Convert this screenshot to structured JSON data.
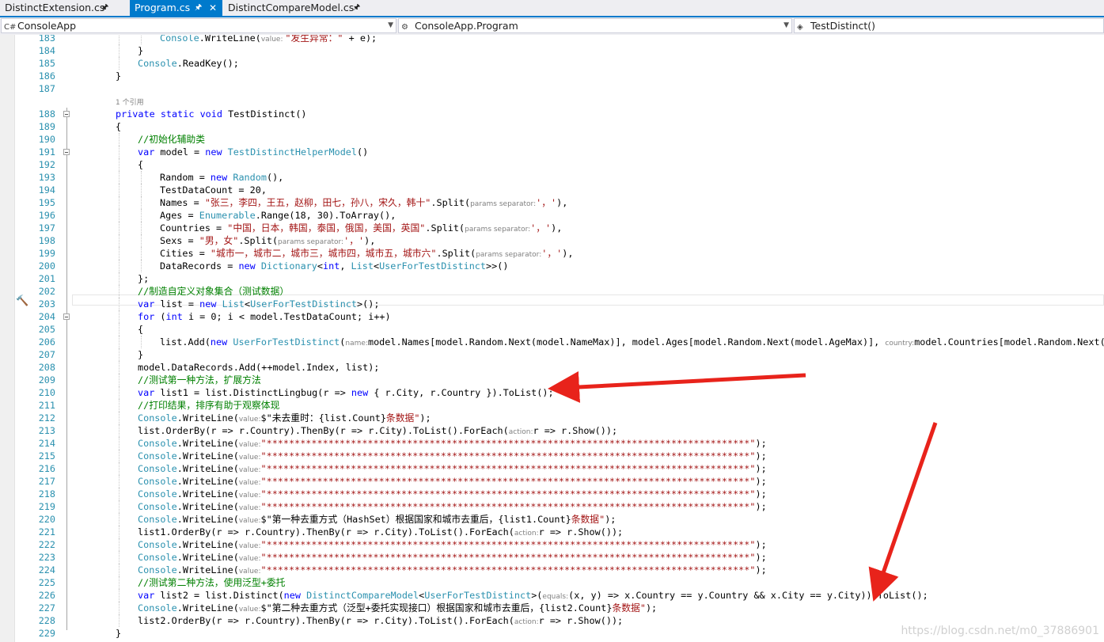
{
  "tabs": [
    {
      "label": "DistinctExtension.cs",
      "active": false
    },
    {
      "label": "Program.cs",
      "active": true
    },
    {
      "label": "DistinctCompareModel.cs",
      "active": false
    }
  ],
  "nav": {
    "project": "ConsoleApp",
    "type": "ConsoleApp.Program",
    "member": "TestDistinct()"
  },
  "colors": {
    "keyword": "#0000ff",
    "type": "#2b91af",
    "string": "#a31515",
    "comment": "#008000",
    "hint": "#808080",
    "accent": "#007acc",
    "arrow": "#e8231b"
  },
  "lines": [
    {
      "n": "183",
      "ind": 2,
      "t": [
        [
          "Console",
          "type"
        ],
        [
          ".WriteLine(",
          ""
        ],
        [
          "value: ",
          "hint"
        ],
        [
          "\"发生异常：\"",
          "string"
        ],
        [
          " + e);",
          ""
        ]
      ]
    },
    {
      "n": "184",
      "ind": 1,
      "t": [
        [
          "}",
          ""
        ]
      ]
    },
    {
      "n": "185",
      "ind": 1,
      "t": [
        [
          "Console",
          "type"
        ],
        [
          ".ReadKey();",
          ""
        ]
      ]
    },
    {
      "n": "186",
      "ind": 0,
      "t": [
        [
          "}",
          ""
        ]
      ]
    },
    {
      "n": "187",
      "ind": 0,
      "t": []
    },
    {
      "n": "",
      "ind": 0,
      "t": [
        [
          "1 个引用",
          "hint"
        ]
      ]
    },
    {
      "n": "188",
      "ind": 0,
      "fold": true,
      "t": [
        [
          "private",
          "keyword"
        ],
        [
          " ",
          ""
        ],
        [
          "static",
          "keyword"
        ],
        [
          " ",
          ""
        ],
        [
          "void",
          "keyword"
        ],
        [
          " TestDistinct()",
          ""
        ]
      ]
    },
    {
      "n": "189",
      "ind": 0,
      "t": [
        [
          "{",
          ""
        ]
      ]
    },
    {
      "n": "190",
      "ind": 1,
      "t": [
        [
          "//初始化辅助类",
          "comment"
        ]
      ]
    },
    {
      "n": "191",
      "ind": 1,
      "fold": true,
      "t": [
        [
          "var",
          "keyword"
        ],
        [
          " model = ",
          ""
        ],
        [
          "new",
          "keyword"
        ],
        [
          " ",
          ""
        ],
        [
          "TestDistinctHelperModel",
          "type"
        ],
        [
          "()",
          ""
        ]
      ]
    },
    {
      "n": "192",
      "ind": 1,
      "t": [
        [
          "{",
          ""
        ]
      ]
    },
    {
      "n": "193",
      "ind": 2,
      "t": [
        [
          "Random = ",
          ""
        ],
        [
          "new",
          "keyword"
        ],
        [
          " ",
          ""
        ],
        [
          "Random",
          "type"
        ],
        [
          "(),",
          ""
        ]
      ]
    },
    {
      "n": "194",
      "ind": 2,
      "t": [
        [
          "TestDataCount = 20,",
          ""
        ]
      ]
    },
    {
      "n": "195",
      "ind": 2,
      "t": [
        [
          "Names = ",
          ""
        ],
        [
          "\"张三，李四，王五，赵柳，田七，孙八，宋久，韩十\"",
          "string"
        ],
        [
          ".Split(",
          ""
        ],
        [
          "params separator:",
          "hint"
        ],
        [
          "'，'",
          "string"
        ],
        [
          "),",
          ""
        ]
      ]
    },
    {
      "n": "196",
      "ind": 2,
      "t": [
        [
          "Ages = ",
          ""
        ],
        [
          "Enumerable",
          "type"
        ],
        [
          ".Range(18, 30).ToArray(),",
          ""
        ]
      ]
    },
    {
      "n": "197",
      "ind": 2,
      "t": [
        [
          "Countries = ",
          ""
        ],
        [
          "\"中国，日本，韩国，泰国，俄国，美国，英国\"",
          "string"
        ],
        [
          ".Split(",
          ""
        ],
        [
          "params separator:",
          "hint"
        ],
        [
          "'，'",
          "string"
        ],
        [
          "),",
          ""
        ]
      ]
    },
    {
      "n": "198",
      "ind": 2,
      "t": [
        [
          "Sexs = ",
          ""
        ],
        [
          "\"男，女\"",
          "string"
        ],
        [
          ".Split(",
          ""
        ],
        [
          "params separator:",
          "hint"
        ],
        [
          "'，'",
          "string"
        ],
        [
          "),",
          ""
        ]
      ]
    },
    {
      "n": "199",
      "ind": 2,
      "t": [
        [
          "Cities = ",
          ""
        ],
        [
          "\"城市一，城市二，城市三，城市四，城市五，城市六\"",
          "string"
        ],
        [
          ".Split(",
          ""
        ],
        [
          "params separator:",
          "hint"
        ],
        [
          "'，'",
          "string"
        ],
        [
          "),",
          ""
        ]
      ]
    },
    {
      "n": "200",
      "ind": 2,
      "t": [
        [
          "DataRecords = ",
          ""
        ],
        [
          "new",
          "keyword"
        ],
        [
          " ",
          ""
        ],
        [
          "Dictionary",
          "type"
        ],
        [
          "<",
          ""
        ],
        [
          "int",
          "keyword"
        ],
        [
          ", ",
          ""
        ],
        [
          "List",
          "type"
        ],
        [
          "<",
          ""
        ],
        [
          "UserForTestDistinct",
          "type"
        ],
        [
          ">>()",
          ""
        ]
      ]
    },
    {
      "n": "201",
      "ind": 1,
      "t": [
        [
          "};",
          ""
        ]
      ]
    },
    {
      "n": "202",
      "ind": 1,
      "t": [
        [
          "//制造自定义对象集合（测试数据）",
          "comment"
        ]
      ]
    },
    {
      "n": "203",
      "ind": 1,
      "t": [
        [
          "var",
          "keyword"
        ],
        [
          " list = ",
          ""
        ],
        [
          "new",
          "keyword"
        ],
        [
          " ",
          ""
        ],
        [
          "List",
          "type"
        ],
        [
          "<",
          ""
        ],
        [
          "UserForTestDistinct",
          "type"
        ],
        [
          ">();",
          ""
        ]
      ]
    },
    {
      "n": "204",
      "ind": 1,
      "fold": true,
      "t": [
        [
          "for",
          "keyword"
        ],
        [
          " (",
          ""
        ],
        [
          "int",
          "keyword"
        ],
        [
          " i = 0; i < model.TestDataCount; i++)",
          ""
        ]
      ]
    },
    {
      "n": "205",
      "ind": 1,
      "t": [
        [
          "{",
          ""
        ]
      ]
    },
    {
      "n": "206",
      "ind": 2,
      "t": [
        [
          "list.Add(",
          ""
        ],
        [
          "new",
          "keyword"
        ],
        [
          " ",
          ""
        ],
        [
          "UserForTestDistinct",
          "type"
        ],
        [
          "(",
          ""
        ],
        [
          "name:",
          "hint"
        ],
        [
          "model.Names[model.Random.Next(model.NameMax)], model.Ages[model.Random.Next(model.AgeMax)], ",
          ""
        ],
        [
          "country:",
          "hint"
        ],
        [
          "model.Countries[model.Random.Next(model.CountryMax)]",
          ""
        ]
      ]
    },
    {
      "n": "207",
      "ind": 1,
      "t": [
        [
          "}",
          ""
        ]
      ]
    },
    {
      "n": "208",
      "ind": 1,
      "t": [
        [
          "model.DataRecords.Add(++model.Index, list);",
          ""
        ]
      ]
    },
    {
      "n": "209",
      "ind": 1,
      "t": [
        [
          "//测试第一种方法，扩展方法",
          "comment"
        ]
      ]
    },
    {
      "n": "210",
      "ind": 1,
      "t": [
        [
          "var",
          "keyword"
        ],
        [
          " list1 = list.DistinctLingbug(r => ",
          ""
        ],
        [
          "new",
          "keyword"
        ],
        [
          " { r.City, r.Country }).ToList();",
          ""
        ]
      ]
    },
    {
      "n": "211",
      "ind": 1,
      "t": [
        [
          "//打印结果，排序有助于观察体现",
          "comment"
        ]
      ]
    },
    {
      "n": "212",
      "ind": 1,
      "t": [
        [
          "Console",
          "type"
        ],
        [
          ".WriteLine(",
          ""
        ],
        [
          "value:",
          "hint"
        ],
        [
          "$\"未去重时：",
          ""
        ],
        [
          "{list.Count}",
          ""
        ],
        [
          "条数据\"",
          "string"
        ],
        [
          ");",
          ""
        ]
      ]
    },
    {
      "n": "213",
      "ind": 1,
      "t": [
        [
          "list.OrderBy(r => r.Country).ThenBy(r => r.City).ToList().ForEach(",
          ""
        ],
        [
          "action:",
          "hint"
        ],
        [
          "r => r.Show());",
          ""
        ]
      ]
    },
    {
      "n": "214",
      "ind": 1,
      "t": [
        [
          "Console",
          "type"
        ],
        [
          ".WriteLine(",
          ""
        ],
        [
          "value:",
          "hint"
        ],
        [
          "\"**************************************************************************************\"",
          "string"
        ],
        [
          ");",
          ""
        ]
      ]
    },
    {
      "n": "215",
      "ind": 1,
      "t": [
        [
          "Console",
          "type"
        ],
        [
          ".WriteLine(",
          ""
        ],
        [
          "value:",
          "hint"
        ],
        [
          "\"**************************************************************************************\"",
          "string"
        ],
        [
          ");",
          ""
        ]
      ]
    },
    {
      "n": "216",
      "ind": 1,
      "t": [
        [
          "Console",
          "type"
        ],
        [
          ".WriteLine(",
          ""
        ],
        [
          "value:",
          "hint"
        ],
        [
          "\"**************************************************************************************\"",
          "string"
        ],
        [
          ");",
          ""
        ]
      ]
    },
    {
      "n": "217",
      "ind": 1,
      "t": [
        [
          "Console",
          "type"
        ],
        [
          ".WriteLine(",
          ""
        ],
        [
          "value:",
          "hint"
        ],
        [
          "\"**************************************************************************************\"",
          "string"
        ],
        [
          ");",
          ""
        ]
      ]
    },
    {
      "n": "218",
      "ind": 1,
      "t": [
        [
          "Console",
          "type"
        ],
        [
          ".WriteLine(",
          ""
        ],
        [
          "value:",
          "hint"
        ],
        [
          "\"**************************************************************************************\"",
          "string"
        ],
        [
          ");",
          ""
        ]
      ]
    },
    {
      "n": "219",
      "ind": 1,
      "t": [
        [
          "Console",
          "type"
        ],
        [
          ".WriteLine(",
          ""
        ],
        [
          "value:",
          "hint"
        ],
        [
          "\"**************************************************************************************\"",
          "string"
        ],
        [
          ");",
          ""
        ]
      ]
    },
    {
      "n": "220",
      "ind": 1,
      "t": [
        [
          "Console",
          "type"
        ],
        [
          ".WriteLine(",
          ""
        ],
        [
          "value:",
          "hint"
        ],
        [
          "$\"第一种去重方式（HashSet）根据国家和城市去重后，",
          ""
        ],
        [
          "{list1.Count}",
          ""
        ],
        [
          "条数据\"",
          "string"
        ],
        [
          ");",
          ""
        ]
      ]
    },
    {
      "n": "221",
      "ind": 1,
      "t": [
        [
          "list1.OrderBy(r => r.Country).ThenBy(r => r.City).ToList().ForEach(",
          ""
        ],
        [
          "action:",
          "hint"
        ],
        [
          "r => r.Show());",
          ""
        ]
      ]
    },
    {
      "n": "222",
      "ind": 1,
      "t": [
        [
          "Console",
          "type"
        ],
        [
          ".WriteLine(",
          ""
        ],
        [
          "value:",
          "hint"
        ],
        [
          "\"**************************************************************************************\"",
          "string"
        ],
        [
          ");",
          ""
        ]
      ]
    },
    {
      "n": "223",
      "ind": 1,
      "t": [
        [
          "Console",
          "type"
        ],
        [
          ".WriteLine(",
          ""
        ],
        [
          "value:",
          "hint"
        ],
        [
          "\"**************************************************************************************\"",
          "string"
        ],
        [
          ");",
          ""
        ]
      ]
    },
    {
      "n": "224",
      "ind": 1,
      "t": [
        [
          "Console",
          "type"
        ],
        [
          ".WriteLine(",
          ""
        ],
        [
          "value:",
          "hint"
        ],
        [
          "\"**************************************************************************************\"",
          "string"
        ],
        [
          ");",
          ""
        ]
      ]
    },
    {
      "n": "225",
      "ind": 1,
      "t": [
        [
          "//测试第二种方法，使用泛型+委托",
          "comment"
        ]
      ]
    },
    {
      "n": "226",
      "ind": 1,
      "t": [
        [
          "var",
          "keyword"
        ],
        [
          " list2 = list.Distinct(",
          ""
        ],
        [
          "new",
          "keyword"
        ],
        [
          " ",
          ""
        ],
        [
          "DistinctCompareModel",
          "type"
        ],
        [
          "<",
          ""
        ],
        [
          "UserForTestDistinct",
          "type"
        ],
        [
          ">(",
          ""
        ],
        [
          "equals:",
          "hint"
        ],
        [
          "(x, y) => x.Country == y.Country && x.City == y.City)).ToList();",
          ""
        ]
      ]
    },
    {
      "n": "227",
      "ind": 1,
      "t": [
        [
          "Console",
          "type"
        ],
        [
          ".WriteLine(",
          ""
        ],
        [
          "value:",
          "hint"
        ],
        [
          "$\"第二种去重方式（泛型+委托实现接口）根据国家和城市去重后，",
          ""
        ],
        [
          "{list2.Count}",
          ""
        ],
        [
          "条数据\"",
          "string"
        ],
        [
          ");",
          ""
        ]
      ]
    },
    {
      "n": "228",
      "ind": 1,
      "t": [
        [
          "list2.OrderBy(r => r.Country).ThenBy(r => r.City).ToList().ForEach(",
          ""
        ],
        [
          "action:",
          "hint"
        ],
        [
          "r => r.Show());",
          ""
        ]
      ]
    },
    {
      "n": "229",
      "ind": 0,
      "t": [
        [
          "}",
          ""
        ]
      ]
    },
    {
      "n": "230",
      "ind": 0,
      "t": []
    }
  ],
  "watermark": "https://blog.csdn.net/m0_37886901"
}
